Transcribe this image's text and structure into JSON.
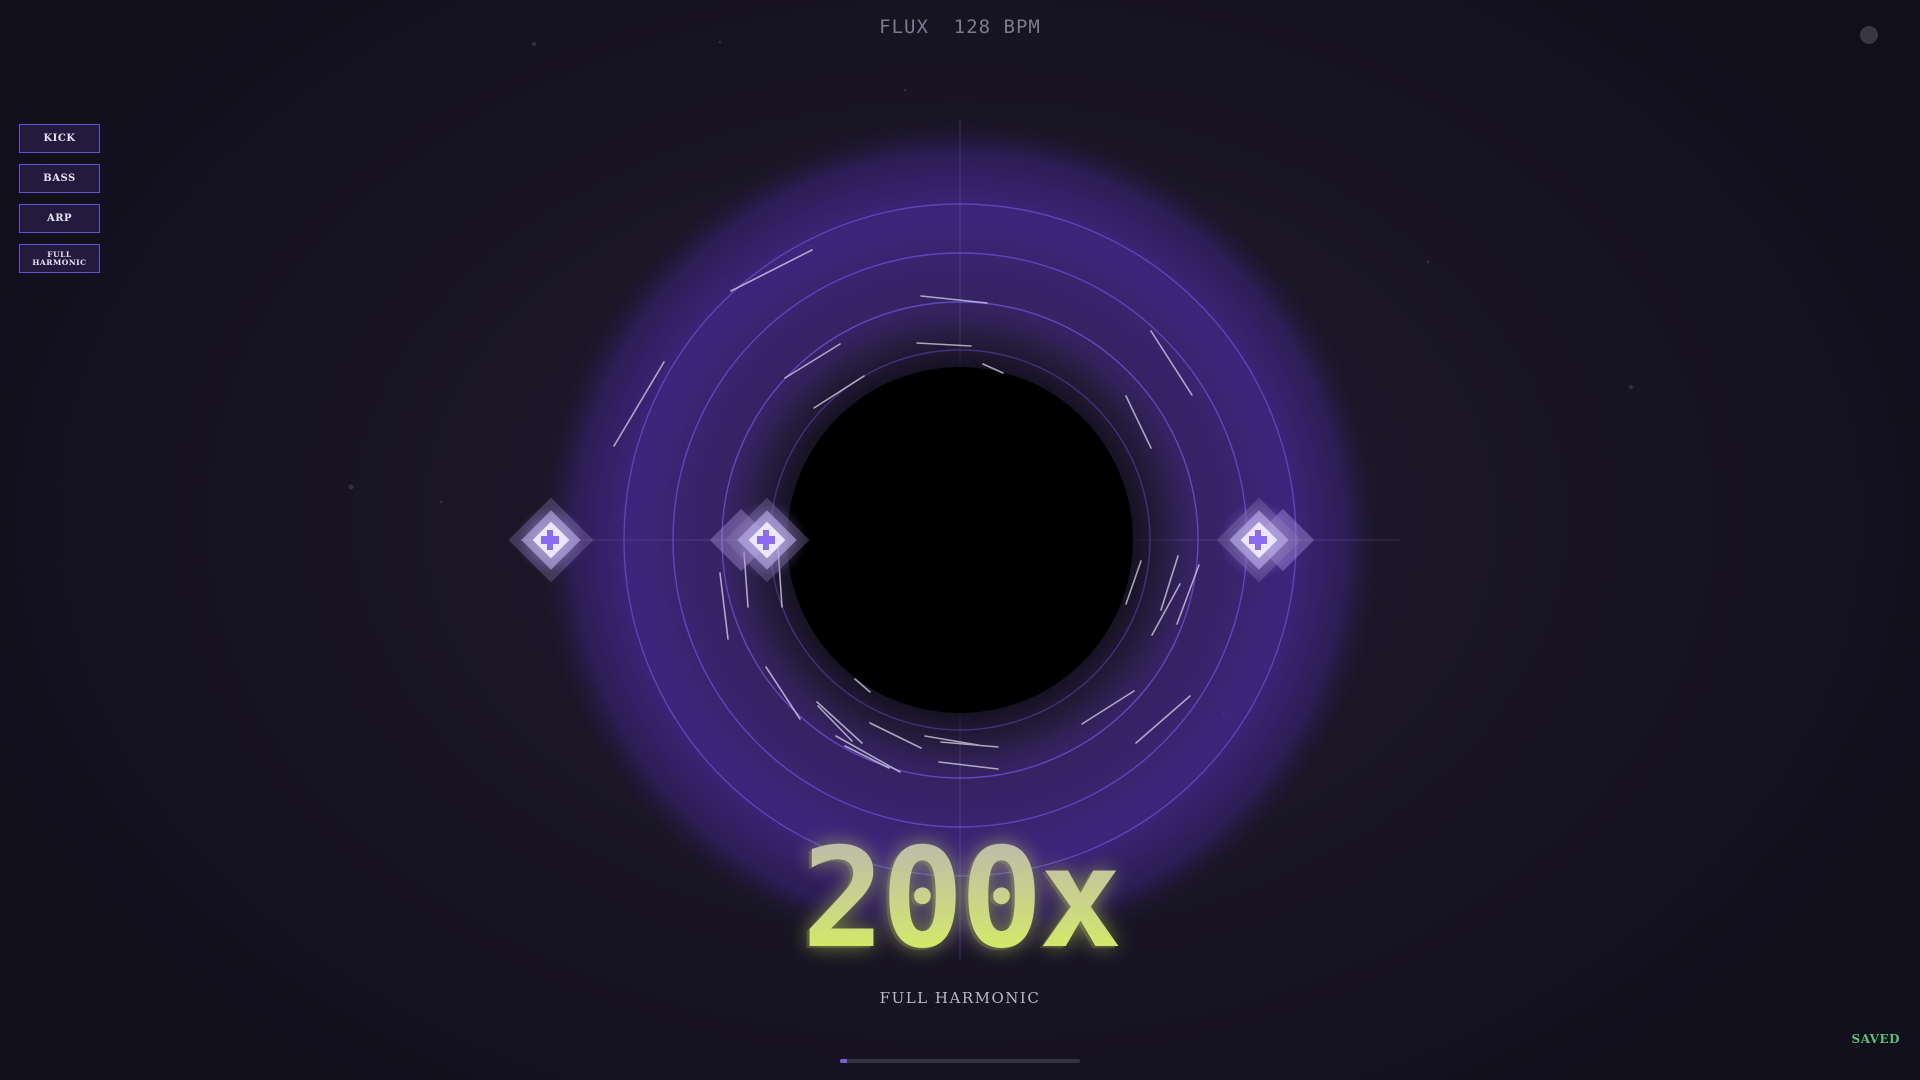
{
  "header": {
    "title": "FLUX  128 BPM"
  },
  "layers": [
    {
      "label": "KICK"
    },
    {
      "label": "BASS"
    },
    {
      "label": "ARP"
    },
    {
      "label": "FULL HARMONIC"
    }
  ],
  "combo": {
    "value": "200x",
    "status": "FULL HARMONIC"
  },
  "progress": {
    "fraction": 0.03
  },
  "save_status": "SAVED",
  "colors": {
    "accent": "#6a4fd0",
    "glow": "#5a3bb0",
    "combo": "#d6f25c",
    "saved": "#57c27a"
  },
  "icons": {
    "settings": "settings-dot-icon",
    "note": "diamond-note-icon"
  }
}
